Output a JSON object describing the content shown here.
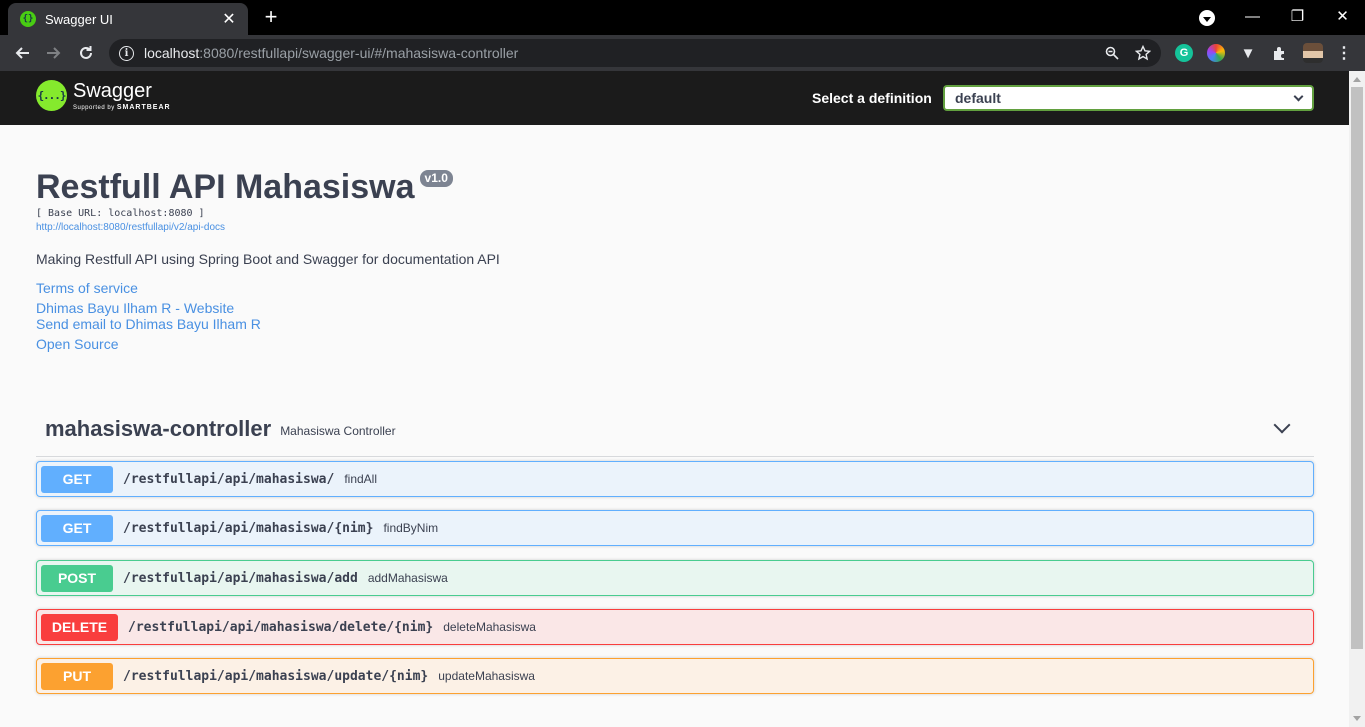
{
  "browser": {
    "tab_title": "Swagger UI",
    "tab_close": "✕",
    "new_tab": "+",
    "url_host": "localhost",
    "url_rest": ":8080/restfullapi/swagger-ui/#/mahasiswa-controller",
    "window_controls": {
      "minimize": "—",
      "restore": "❐",
      "close": "✕"
    }
  },
  "swagger": {
    "logo_name": "Swagger",
    "logo_sub_prefix": "Supported by ",
    "logo_sub_brand": "SMARTBEAR",
    "definition_label": "Select a definition",
    "definition_value": "default"
  },
  "info": {
    "title": "Restfull API Mahasiswa",
    "version": "v1.0",
    "base_url": "[ Base URL: localhost:8080 ]",
    "api_docs_link": "http://localhost:8080/restfullapi/v2/api-docs",
    "description": "Making Restfull API using Spring Boot and Swagger for documentation API",
    "terms": "Terms of service",
    "contact_website": "Dhimas Bayu Ilham R - Website",
    "contact_email": "Send email to Dhimas Bayu Ilham R",
    "license": "Open Source"
  },
  "tag": {
    "name": "mahasiswa-controller",
    "description": "Mahasiswa Controller"
  },
  "operations": [
    {
      "method": "GET",
      "path": "/restfullapi/api/mahasiswa/",
      "summary": "findAll",
      "color": "#61affe",
      "bg": "#ebf3fb"
    },
    {
      "method": "GET",
      "path": "/restfullapi/api/mahasiswa/{nim}",
      "summary": "findByNim",
      "color": "#61affe",
      "bg": "#ebf3fb"
    },
    {
      "method": "POST",
      "path": "/restfullapi/api/mahasiswa/add",
      "summary": "addMahasiswa",
      "color": "#49cc90",
      "bg": "#e8f6f0"
    },
    {
      "method": "DELETE",
      "path": "/restfullapi/api/mahasiswa/delete/{nim}",
      "summary": "deleteMahasiswa",
      "color": "#f93e3e",
      "bg": "#fae7e7"
    },
    {
      "method": "PUT",
      "path": "/restfullapi/api/mahasiswa/update/{nim}",
      "summary": "updateMahasiswa",
      "color": "#fca130",
      "bg": "#fcf1e6"
    }
  ]
}
